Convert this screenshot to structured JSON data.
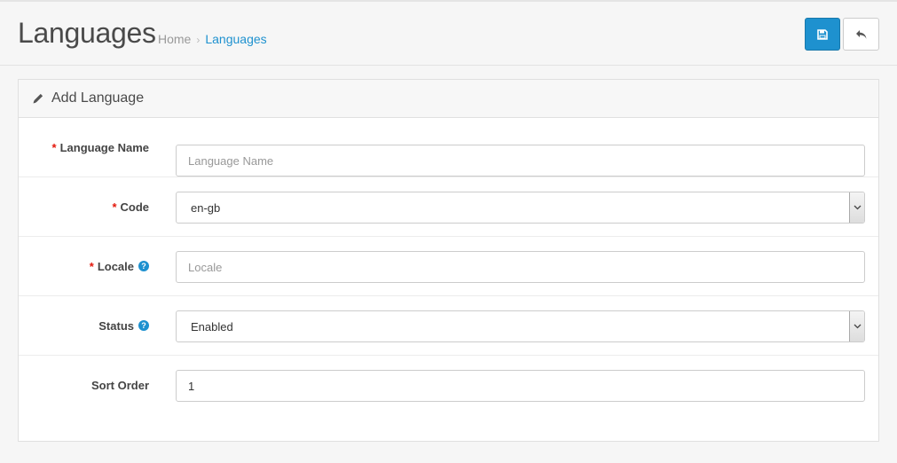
{
  "header": {
    "title": "Languages",
    "breadcrumb": [
      {
        "label": "Home"
      },
      {
        "label": "Languages"
      }
    ],
    "save_icon": "save-icon",
    "back_icon": "reply-icon"
  },
  "panel": {
    "title": "Add Language",
    "title_icon": "pencil-icon"
  },
  "form": {
    "language_name": {
      "label": "Language Name",
      "required": true,
      "value": "",
      "placeholder": "Language Name"
    },
    "code": {
      "label": "Code",
      "required": true,
      "value": "en-gb"
    },
    "locale": {
      "label": "Locale",
      "required": true,
      "help": "?",
      "value": "",
      "placeholder": "Locale"
    },
    "status": {
      "label": "Status",
      "required": false,
      "help": "?",
      "value": "Enabled"
    },
    "sort_order": {
      "label": "Sort Order",
      "required": false,
      "value": "1"
    }
  },
  "required_mark": "*",
  "colors": {
    "primary": "#1e91cf",
    "required": "#e3170b"
  }
}
